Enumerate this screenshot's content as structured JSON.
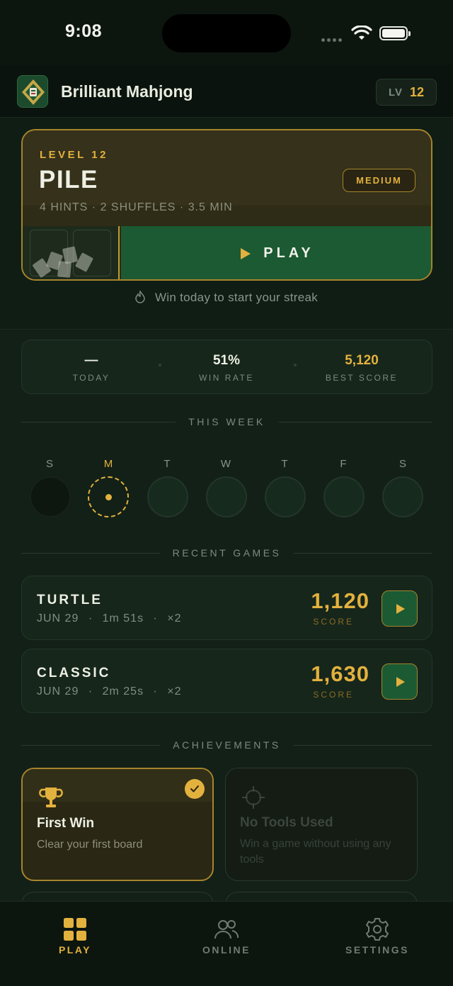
{
  "status": {
    "time": "9:08"
  },
  "app": {
    "name": "Brilliant Mahjong",
    "level_prefix": "LV",
    "level": "12"
  },
  "level_card": {
    "kicker": "LEVEL 12",
    "title": "PILE",
    "difficulty": "MEDIUM",
    "meta": "4 HINTS · 2 SHUFFLES · 3.5 MIN",
    "play_label": "PLAY"
  },
  "streak_text": "Win today to start your streak",
  "stats": [
    {
      "value": "—",
      "label": "TODAY"
    },
    {
      "value": "51%",
      "label": "WIN RATE"
    },
    {
      "value": "5,120",
      "label": "BEST SCORE"
    }
  ],
  "week": {
    "title": "THIS WEEK",
    "days": [
      "S",
      "M",
      "T",
      "W",
      "T",
      "F",
      "S"
    ],
    "today_index": 1
  },
  "recent_games": {
    "title": "RECENT GAMES",
    "items": [
      {
        "name": "TURTLE",
        "date": "JUN 29",
        "duration": "1m 51s",
        "multiplier": "×2",
        "score": "1,120",
        "score_label": "SCORE"
      },
      {
        "name": "CLASSIC",
        "date": "JUN 29",
        "duration": "2m 25s",
        "multiplier": "×2",
        "score": "1,630",
        "score_label": "SCORE"
      }
    ]
  },
  "achievements": {
    "title": "ACHIEVEMENTS",
    "items": [
      {
        "name": "First Win",
        "desc": "Clear your first board",
        "icon": "trophy-icon",
        "completed": true
      },
      {
        "name": "No Tools Used",
        "desc": "Win a game without using any tools",
        "icon": "crosshair-icon",
        "completed": false
      }
    ]
  },
  "tabs": [
    {
      "label": "PLAY",
      "icon": "grid-icon",
      "active": true
    },
    {
      "label": "ONLINE",
      "icon": "users-icon",
      "active": false
    },
    {
      "label": "SETTINGS",
      "icon": "gear-icon",
      "active": false
    }
  ],
  "colors": {
    "accent": "#e3b13e",
    "green": "#1b5a33",
    "background": "#0f1d14"
  }
}
